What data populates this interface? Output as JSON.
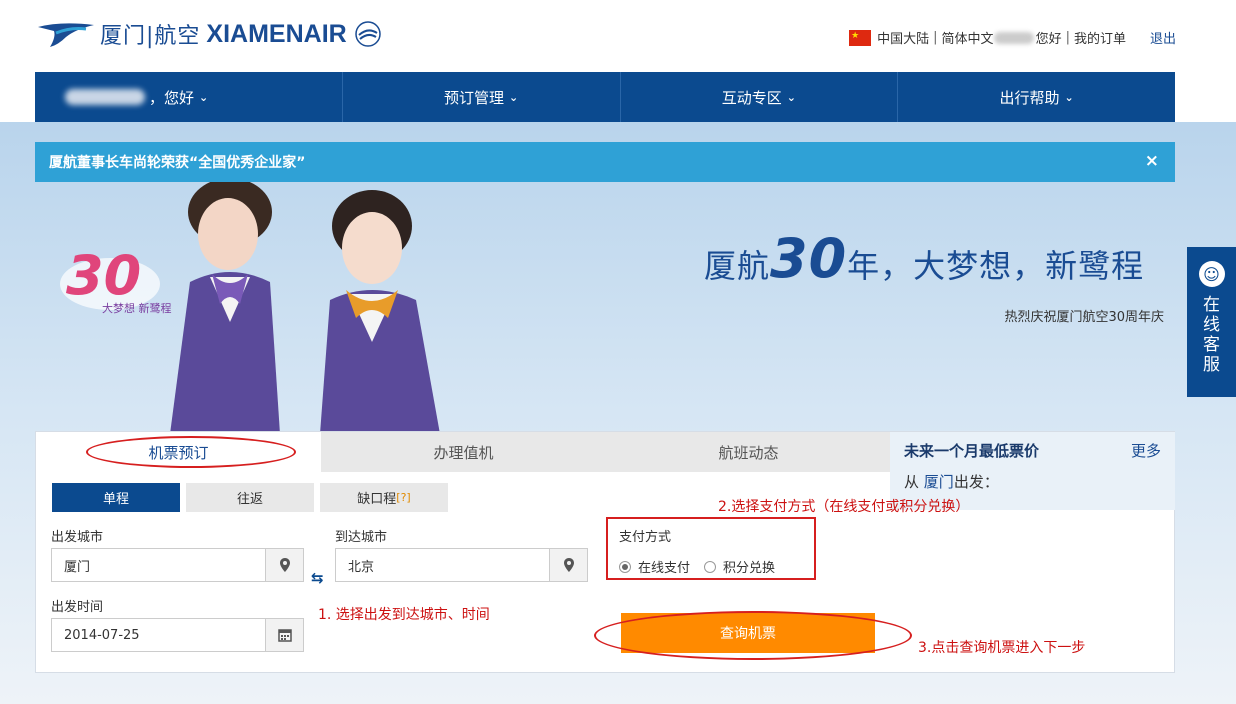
{
  "header": {
    "logo_cn": "厦门|航空",
    "logo_en": "XIAMENAIR",
    "region": "中国大陆",
    "language": "简体中文",
    "greeting": "您好",
    "my_orders": "我的订单",
    "logout": "退出"
  },
  "nav": {
    "items": [
      {
        "label": "，您好"
      },
      {
        "label": "预订管理"
      },
      {
        "label": "互动专区"
      },
      {
        "label": "出行帮助"
      }
    ]
  },
  "notice": {
    "text": "厦航董事长车尚轮荣获“全国优秀企业家”",
    "close": "×"
  },
  "banner": {
    "slogan_pre": "厦航",
    "slogan_num": "30",
    "slogan_post": "年，大梦想，新鹭程",
    "sub": "热烈庆祝厦门航空30周年庆",
    "badge_num": "30",
    "badge_text": "大梦想 新鹭程"
  },
  "chat": {
    "label": "在线客服"
  },
  "booking": {
    "tabs": [
      "机票预订",
      "办理值机",
      "航班动态"
    ],
    "trip_types": [
      "单程",
      "往返",
      "缺口程"
    ],
    "trip_help": "[?]",
    "depart_city_label": "出发城市",
    "depart_city_value": "厦门",
    "arrive_city_label": "到达城市",
    "arrive_city_value": "北京",
    "depart_date_label": "出发时间",
    "depart_date_value": "2014-07-25",
    "payment_label": "支付方式",
    "payment_options": [
      "在线支付",
      "积分兑换"
    ],
    "search_button": "查询机票"
  },
  "lowest_fare": {
    "title": "未来一个月最低票价",
    "more": "更多",
    "from_prefix": "从",
    "from_city": "厦门",
    "from_suffix": "出发："
  },
  "annotations": {
    "step1": "1. 选择出发到达城市、时间",
    "step2": "2.选择支付方式（在线支付或积分兑换）",
    "step3": "3.点击查询机票进入下一步"
  },
  "colors": {
    "brand_blue": "#0b4a8f",
    "notice_blue": "#2fa1d6",
    "search_orange": "#ff8a00",
    "annotation_red": "#d61f1f"
  }
}
